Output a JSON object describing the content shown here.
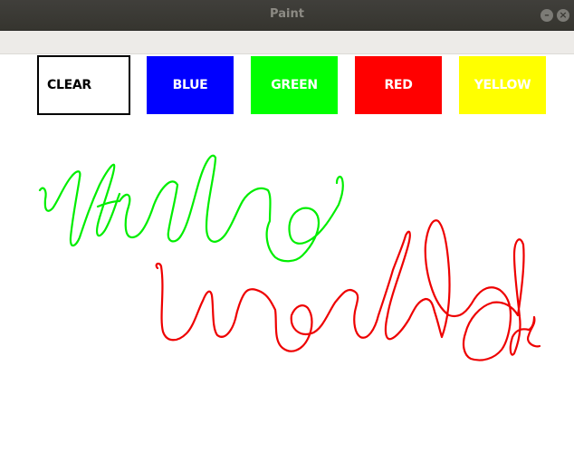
{
  "window": {
    "title": "Paint"
  },
  "toolbar": {
    "buttons": [
      {
        "label": "CLEAR",
        "color": "#ffffff"
      },
      {
        "label": "BLUE",
        "color": "#0000ff"
      },
      {
        "label": "GREEN",
        "color": "#00ff00"
      },
      {
        "label": "RED",
        "color": "#ff0000"
      },
      {
        "label": "YELLOW",
        "color": "#ffff00"
      }
    ]
  },
  "drawing": {
    "strokes": [
      {
        "color": "#00ff00",
        "description": "handwritten hello"
      },
      {
        "color": "#ff0000",
        "description": "handwritten world"
      }
    ]
  }
}
